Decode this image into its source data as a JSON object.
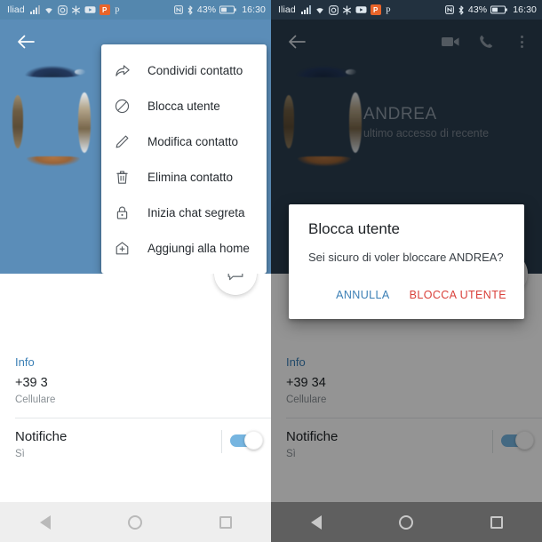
{
  "statusbar": {
    "carrier": "Iliad",
    "battery": "43%",
    "time": "16:30",
    "icons": [
      "signal-icon",
      "wifi-icon",
      "instagram-icon",
      "bluetooth-sharing-icon",
      "youtube-icon",
      "playstore-badge-icon",
      "pinterest-icon"
    ],
    "right_icons": [
      "nfc-icon",
      "bluetooth-icon",
      "battery-icon"
    ],
    "badge_letter": "P"
  },
  "left_phone": {
    "header": {
      "back_label": "back-arrow",
      "avatar": "contact-photo"
    },
    "menu": {
      "items": [
        {
          "icon": "share-icon",
          "label": "Condividi contatto"
        },
        {
          "icon": "block-icon",
          "label": "Blocca utente"
        },
        {
          "icon": "pencil-icon",
          "label": "Modifica contatto"
        },
        {
          "icon": "trash-icon",
          "label": "Elimina contatto"
        },
        {
          "icon": "lock-icon",
          "label": "Inizia chat segreta"
        },
        {
          "icon": "add-home-icon",
          "label": "Aggiungi alla home"
        }
      ]
    },
    "info": {
      "title": "Info",
      "phone": "+39 3",
      "phone_type": "Cellulare",
      "notifications_title": "Notifiche",
      "notifications_value": "Sì",
      "toggle_state": "on"
    },
    "fab": "chat-bubble-icon"
  },
  "right_phone": {
    "header": {
      "back_label": "back-arrow",
      "name": "ANDREA",
      "status": "ultimo accesso di recente",
      "actions": [
        "video-call-icon",
        "phone-call-icon",
        "overflow-menu-icon"
      ]
    },
    "dialog": {
      "title": "Blocca utente",
      "message": "Sei sicuro di voler bloccare ANDREA?",
      "cancel_label": "ANNULLA",
      "confirm_label": "BLOCCA UTENTE"
    },
    "info": {
      "title": "Info",
      "phone": "+39 34",
      "phone_type": "Cellulare",
      "notifications_title": "Notifiche",
      "notifications_value": "Sì",
      "toggle_state": "on"
    },
    "fab": "chat-bubble-icon"
  },
  "navbar": {
    "back": "nav-back-triangle",
    "home": "nav-home-circle",
    "recents": "nav-recents-square"
  },
  "colors": {
    "left_header": "#5b8db8",
    "right_header": "#2a3d4f",
    "accent_blue": "#3b7fb5",
    "danger_red": "#d9403a",
    "toggle_on": "#76b5e0"
  }
}
